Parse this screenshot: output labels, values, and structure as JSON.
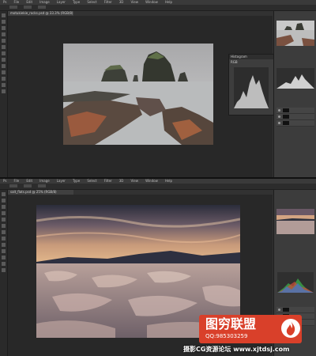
{
  "top_window": {
    "menu": [
      "Ps",
      "File",
      "Edit",
      "Image",
      "Layer",
      "Type",
      "Select",
      "Filter",
      "3D",
      "View",
      "Window",
      "Help"
    ],
    "tab_title": "motukiekie_rocks.psd @ 33.3% (RGB/8)",
    "histogram_title": "Histogram",
    "channel": "RGB"
  },
  "bottom_window": {
    "menu": [
      "Ps",
      "File",
      "Edit",
      "Image",
      "Layer",
      "Type",
      "Select",
      "Filter",
      "3D",
      "View",
      "Window",
      "Help"
    ],
    "tab_title": "salt_flats.psd @ 25% (RGB/8)"
  },
  "watermark": {
    "brand": "图穷联盟",
    "qq": "QQ:985303259",
    "site": "摄影CG资源论坛 www.xjtdsj.com"
  },
  "colors": {
    "accent": "#d9402a",
    "ui_dark": "#323232"
  }
}
